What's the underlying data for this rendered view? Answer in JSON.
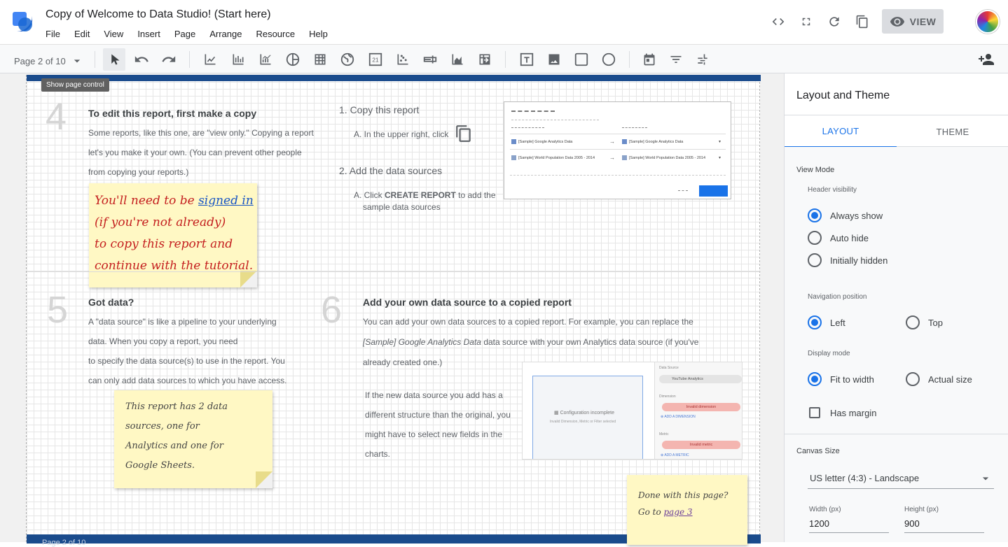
{
  "app": {
    "title": "Copy of Welcome to Data Studio! (Start here)",
    "menu": [
      "File",
      "Edit",
      "View",
      "Insert",
      "Page",
      "Arrange",
      "Resource",
      "Help"
    ],
    "view_label": "VIEW",
    "accent": "#1a73e8"
  },
  "toolbar": {
    "page_control": "Page 2 of 10",
    "tooltip": "Show page control"
  },
  "report": {
    "step4": {
      "num": "4",
      "title": "To edit this report, first make a copy",
      "body": [
        "Some reports, like this one, are \"view only.\" Copying a report",
        "let's you make it your own. (You can prevent other people",
        "from copying your reports.)"
      ]
    },
    "copy_steps": {
      "step1": "1. Copy this report",
      "step1a": "A. In the upper right, click",
      "step2": "2. Add the data sources",
      "step2a_prefix": "A. Click ",
      "step2a_bold": "CREATE REPORT",
      "step2a_suffix": " to add the",
      "step2a_line2": "sample data sources"
    },
    "mini_dialog": {
      "row1_left": "[Sample] Google Analytics Data",
      "row1_right": "[Sample] Google Analytics Data",
      "row2_left": "[Sample] World Population Data 2005 - 2014",
      "row2_right": "[Sample] World Population Data 2005 - 2014"
    },
    "note1": {
      "line1_prefix": "You'll need to be ",
      "line1_link": "signed in",
      "line2": "(if you're not already)",
      "line3": "to copy this report and",
      "line4": "continue with the tutorial."
    },
    "step5": {
      "num": "5",
      "title": "Got data?",
      "body": [
        "A \"data source\" is like a pipeline to your underlying",
        "data. When you copy a report, you need",
        "to specify the data source(s) to use in the report. You",
        "can only add data sources to which you have access."
      ]
    },
    "note2": {
      "lines": [
        "This report has 2 data",
        "sources, one for",
        "Analytics and one for",
        "Google Sheets."
      ]
    },
    "step6": {
      "num": "6",
      "title": "Add your own data source to a copied report",
      "body_line1": "You can add your own data sources to a copied report. For example, you can replace the",
      "body_line2_italic": "[Sample] Google Analytics Data",
      "body_line2_rest": " data source with your own Analytics data source (if you've",
      "body_line3": "already created one.)",
      "body2": [
        "If the new data source you add has a",
        "different structure than the original, you",
        "might have to select new fields in the",
        "charts."
      ]
    },
    "mini_config": {
      "incomplete": "Configuration incomplete",
      "incomplete_sub": "Invalid Dimension, Metric or Filter selected",
      "data_source_label": "Data Source",
      "data_source": "YouTube Analytics",
      "dimension_label": "Dimension",
      "invalid_dimension": "Invalid dimension",
      "add_dimension": "ADD A DIMENSION",
      "metric_label": "Metric",
      "invalid_metric": "Invalid metric",
      "add_metric": "ADD A METRIC"
    },
    "note3": {
      "line1": "Done with this page?",
      "line2_prefix": "Go to ",
      "line2_link": "page 3"
    },
    "footer_label": "Page 2 of 10"
  },
  "panel": {
    "title": "Layout and Theme",
    "tabs": [
      "LAYOUT",
      "THEME"
    ],
    "view_mode": "View Mode",
    "header_visibility": "Header visibility",
    "header_options": [
      "Always show",
      "Auto hide",
      "Initially hidden"
    ],
    "navigation_position": "Navigation position",
    "nav_options": [
      "Left",
      "Top"
    ],
    "display_mode": "Display mode",
    "display_options": [
      "Fit to width",
      "Actual size"
    ],
    "has_margin": "Has margin",
    "canvas_size": "Canvas Size",
    "canvas_select": "US letter (4:3) - Landscape",
    "width_label": "Width (px)",
    "width_value": "1200",
    "height_label": "Height (px)",
    "height_value": "900"
  }
}
